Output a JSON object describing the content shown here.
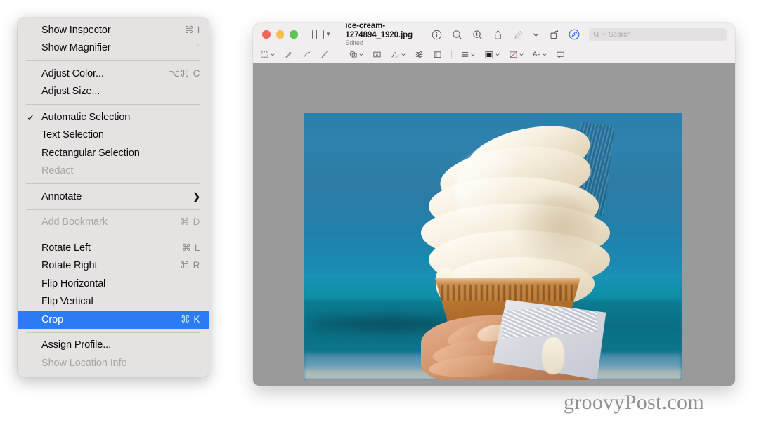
{
  "context_menu": {
    "groups": [
      [
        {
          "label": "Show Inspector",
          "shortcut": "⌘ I",
          "state": "normal",
          "icon": ""
        },
        {
          "label": "Show Magnifier",
          "shortcut": "`",
          "state": "faint",
          "icon": ""
        }
      ],
      [
        {
          "label": "Adjust Color...",
          "shortcut": "⌥⌘ C",
          "state": "normal",
          "icon": ""
        },
        {
          "label": "Adjust Size...",
          "shortcut": "",
          "state": "normal",
          "icon": ""
        }
      ],
      [
        {
          "label": "Automatic Selection",
          "shortcut": "",
          "state": "checked",
          "icon": "checkmark-icon"
        },
        {
          "label": "Text Selection",
          "shortcut": "",
          "state": "normal",
          "icon": ""
        },
        {
          "label": "Rectangular Selection",
          "shortcut": "",
          "state": "normal",
          "icon": ""
        },
        {
          "label": "Redact",
          "shortcut": "",
          "state": "disabled",
          "icon": ""
        }
      ],
      [
        {
          "label": "Annotate",
          "shortcut": "",
          "state": "submenu",
          "icon": "chevron-right-icon"
        }
      ],
      [
        {
          "label": "Add Bookmark",
          "shortcut": "⌘ D",
          "state": "disabled",
          "icon": ""
        }
      ],
      [
        {
          "label": "Rotate Left",
          "shortcut": "⌘ L",
          "state": "normal",
          "icon": ""
        },
        {
          "label": "Rotate Right",
          "shortcut": "⌘ R",
          "state": "normal",
          "icon": ""
        },
        {
          "label": "Flip Horizontal",
          "shortcut": "",
          "state": "normal",
          "icon": ""
        },
        {
          "label": "Flip Vertical",
          "shortcut": "",
          "state": "normal",
          "icon": ""
        },
        {
          "label": "Crop",
          "shortcut": "⌘ K",
          "state": "selected",
          "icon": ""
        }
      ],
      [
        {
          "label": "Assign Profile...",
          "shortcut": "",
          "state": "normal",
          "icon": ""
        },
        {
          "label": "Show Location Info",
          "shortcut": "",
          "state": "disabled",
          "icon": ""
        }
      ]
    ],
    "highlight_color": "#2b7cf4"
  },
  "preview_window": {
    "title": "ice-cream-1274894_1920.jpg",
    "subtitle": "Edited",
    "traffic_lights": [
      {
        "name": "close",
        "color": "#f4655a"
      },
      {
        "name": "minimize",
        "color": "#f6bd4f"
      },
      {
        "name": "zoom",
        "color": "#61c455"
      }
    ],
    "sidebar_toggle": "sidebar-toggle-icon",
    "toolbar_icons": [
      {
        "name": "info-icon",
        "state": "normal"
      },
      {
        "name": "zoom-out-icon",
        "state": "normal"
      },
      {
        "name": "zoom-in-icon",
        "state": "normal"
      },
      {
        "name": "share-icon",
        "state": "normal"
      },
      {
        "name": "markup-pen-icon",
        "state": "dim"
      },
      {
        "name": "chevron-down-icon",
        "state": "normal"
      },
      {
        "name": "rotate-icon",
        "state": "normal"
      },
      {
        "name": "annotate-circle-icon",
        "state": "active"
      }
    ],
    "search": {
      "placeholder": "Search",
      "value": "",
      "icon": "search-icon"
    },
    "markup_toolbar": [
      {
        "name": "selection-tool-icon",
        "chevron": true
      },
      {
        "name": "instant-alpha-icon",
        "chevron": false
      },
      {
        "name": "sketch-tool-icon",
        "chevron": false
      },
      {
        "name": "draw-tool-icon",
        "chevron": false
      },
      {
        "name": "shapes-tool-icon",
        "chevron": true
      },
      {
        "name": "text-tool-icon",
        "chevron": false
      },
      {
        "name": "sign-tool-icon",
        "chevron": true
      },
      {
        "name": "adjust-tool-icon",
        "chevron": false
      },
      {
        "name": "mask-tool-icon",
        "chevron": false
      },
      {
        "name": "line-style-icon",
        "chevron": true
      },
      {
        "name": "fill-color-icon",
        "chevron": true
      },
      {
        "name": "border-color-icon",
        "chevron": true
      },
      {
        "name": "text-style-icon",
        "chevron": true,
        "caption": "Aa"
      },
      {
        "name": "note-tool-icon",
        "chevron": false
      }
    ],
    "canvas_color": "#9a9a9a"
  },
  "watermark": {
    "text": "groovyPost.com"
  }
}
